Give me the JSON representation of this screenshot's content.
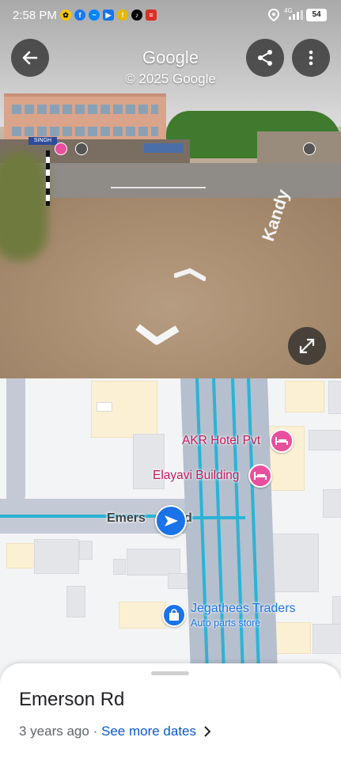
{
  "status_bar": {
    "time": "2:58 PM",
    "network": "4G",
    "battery": "54",
    "app_icons": [
      "snapchat-icon",
      "facebook-icon",
      "messenger-icon",
      "youtube-icon",
      "notification-icon",
      "tiktok-icon",
      "news-icon"
    ]
  },
  "street_view": {
    "title": "Google",
    "copyright": "© 2025 Google",
    "road_text": "Kandy",
    "store_sign": "SINGH",
    "back_icon": "arrow-left-icon",
    "share_icon": "share-icon",
    "menu_icon": "more-vert-icon",
    "expand_icon": "expand-icon"
  },
  "map": {
    "road_label_left": "Emers",
    "road_label_right": "d",
    "pois": [
      {
        "name": "AKR Hotel Pvt",
        "type": "hotel"
      },
      {
        "name": "Elayavi Building",
        "type": "hotel"
      }
    ],
    "store": {
      "name": "Jegathees Traders",
      "category": "Auto parts store"
    },
    "colors": {
      "road_route": "#2bb3d6",
      "poi": "#c2185b",
      "store": "#1a73e8"
    }
  },
  "sheet": {
    "street_name": "Emerson Rd",
    "time_ago": "3 years ago",
    "separator": "·",
    "see_more": "See more dates",
    "chevron_icon": "chevron-right-icon"
  }
}
